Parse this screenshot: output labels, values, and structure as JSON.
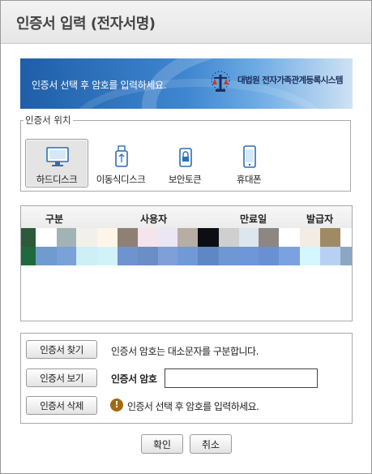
{
  "dialog": {
    "title": "인증서 입력 (전자서명)"
  },
  "banner": {
    "text": "인증서 선택 후 암호를 입력하세요.",
    "org": "대법원 전자가족관계등록시스템"
  },
  "location": {
    "legend": "인증서 위치",
    "devices": [
      {
        "label": "하드디스크",
        "icon": "monitor-icon",
        "selected": true
      },
      {
        "label": "이동식디스크",
        "icon": "usb-icon",
        "selected": false
      },
      {
        "label": "보안토큰",
        "icon": "lock-token-icon",
        "selected": false
      },
      {
        "label": "휴대폰",
        "icon": "phone-icon",
        "selected": false
      }
    ]
  },
  "cert_list": {
    "columns": [
      "구분",
      "사용자",
      "만료일",
      "발급자"
    ]
  },
  "actions": {
    "find_label": "인증서 찾기",
    "view_label": "인증서 보기",
    "delete_label": "인증서 삭제",
    "info_text": "인증서 암호는 대소문자를 구분합니다.",
    "password_label": "인증서 암호",
    "password_value": "",
    "warning_text": "인증서 선택 후 암호를 입력하세요."
  },
  "footer": {
    "ok_label": "확인",
    "cancel_label": "취소"
  }
}
